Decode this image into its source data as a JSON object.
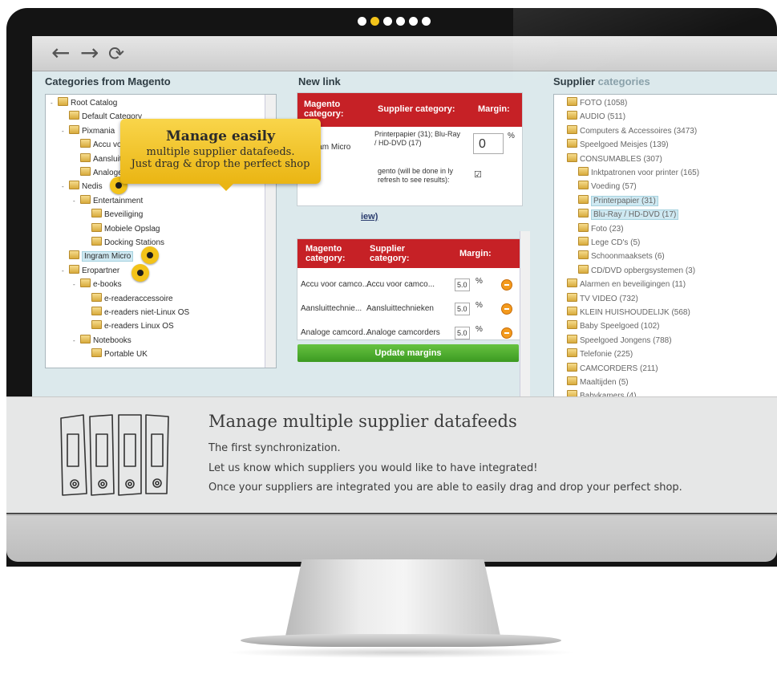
{
  "carousel": {
    "dots": [
      {
        "active": false
      },
      {
        "active": true
      },
      {
        "active": false
      },
      {
        "active": false
      },
      {
        "active": false
      },
      {
        "active": false
      }
    ]
  },
  "browser": {
    "back_icon": "back-arrow-icon",
    "forward_icon": "forward-arrow-icon",
    "refresh_icon": "refresh-icon",
    "back": "←",
    "forward": "→",
    "refresh": "⟳"
  },
  "left_panel": {
    "title": "Categories from Magento",
    "tree": [
      {
        "label": "Root Catalog",
        "depth": 0,
        "expander": "-"
      },
      {
        "label": "Default Category",
        "depth": 1
      },
      {
        "label": "Pixmania",
        "depth": 1,
        "expander": "-"
      },
      {
        "label": "Accu voor camcorder",
        "depth": 2
      },
      {
        "label": "Aansluittechnieken",
        "depth": 2
      },
      {
        "label": "Analoge camcorders",
        "depth": 2
      },
      {
        "label": "Nedis",
        "depth": 1,
        "expander": "-"
      },
      {
        "label": "Entertainment",
        "depth": 2,
        "expander": "-"
      },
      {
        "label": "Beveiliging",
        "depth": 3
      },
      {
        "label": "Mobiele Opslag",
        "depth": 3
      },
      {
        "label": "Docking Stations",
        "depth": 3
      },
      {
        "label": "Ingram Micro",
        "depth": 1,
        "selected": true
      },
      {
        "label": "Eropartner",
        "depth": 1,
        "expander": "-"
      },
      {
        "label": "e-books",
        "depth": 2,
        "expander": "-"
      },
      {
        "label": "e-readeraccessoire",
        "depth": 3
      },
      {
        "label": "e-readers niet-Linux OS",
        "depth": 3
      },
      {
        "label": "e-readers Linux OS",
        "depth": 3
      },
      {
        "label": "Notebooks",
        "depth": 2,
        "expander": "-"
      },
      {
        "label": "Portable UK",
        "depth": 3
      }
    ]
  },
  "callout": {
    "title": "Manage easily",
    "line1": "multiple supplier datafeeds.",
    "line2": "Just drag & drop the perfect shop"
  },
  "middle_panel": {
    "title": "New link",
    "link_table": {
      "headers": [
        "Magento category:",
        "Supplier category:",
        "Margin:"
      ],
      "magento": "Ingram Micro",
      "supplier": "Printerpapier (31); Blu-Ray / HD-DVD (17)",
      "margin_value": "0",
      "percent": "%",
      "note": "gento (will be done in ly refresh to see results):",
      "checkbox": "☑"
    },
    "overview_link": "iew)",
    "margins_table": {
      "headers": [
        "Magento category:",
        "Supplier category:",
        "Margin:"
      ],
      "rows": [
        {
          "magento": "Accu voor camco...",
          "supplier": "Accu voor camco...",
          "margin": "5.0",
          "percent": "%"
        },
        {
          "magento": "Aansluittechnie...",
          "supplier": "Aansluittechnieken",
          "margin": "5.0",
          "percent": "%"
        },
        {
          "magento": "Analoge camcord...",
          "supplier": "Analoge camcorders",
          "margin": "5.0",
          "percent": "%"
        }
      ]
    },
    "update_button": "Update margins"
  },
  "right_panel": {
    "title_strong": "Supplier",
    "title_light": "categories",
    "tree": [
      {
        "label": "FOTO (1058)",
        "depth": 0
      },
      {
        "label": "AUDIO (511)",
        "depth": 0
      },
      {
        "label": "Computers & Accessoires (3473)",
        "depth": 0
      },
      {
        "label": "Speelgoed Meisjes (139)",
        "depth": 0
      },
      {
        "label": "CONSUMABLES (307)",
        "depth": 0
      },
      {
        "label": "Inktpatronen voor printer (165)",
        "depth": 1
      },
      {
        "label": "Voeding (57)",
        "depth": 1
      },
      {
        "label": "Printerpapier (31)",
        "depth": 1,
        "selected": true
      },
      {
        "label": "Blu-Ray / HD-DVD (17)",
        "depth": 1,
        "selected": true
      },
      {
        "label": "Foto (23)",
        "depth": 1
      },
      {
        "label": "Lege CD's (5)",
        "depth": 1
      },
      {
        "label": "Schoonmaaksets (6)",
        "depth": 1
      },
      {
        "label": "CD/DVD opbergsystemen (3)",
        "depth": 1
      },
      {
        "label": "Alarmen en beveiligingen (11)",
        "depth": 0
      },
      {
        "label": "TV VIDEO (732)",
        "depth": 0
      },
      {
        "label": "KLEIN HUISHOUDELIJK (568)",
        "depth": 0
      },
      {
        "label": "Baby Speelgoed (102)",
        "depth": 0
      },
      {
        "label": "Speelgoed Jongens (788)",
        "depth": 0
      },
      {
        "label": "Telefonie (225)",
        "depth": 0
      },
      {
        "label": "CAMCORDERS (211)",
        "depth": 0
      },
      {
        "label": "Maaltijden (5)",
        "depth": 0
      },
      {
        "label": "Babykamers (4)",
        "depth": 0
      }
    ]
  },
  "info": {
    "icon": "binders-icon",
    "heading": "Manage multiple supplier datafeeds",
    "lines": [
      "The first synchronization.",
      "Let us know which suppliers you would like to have integrated!",
      "Once your suppliers are integrated you are able to easily drag and drop your perfect shop."
    ]
  },
  "colors": {
    "accent": "#f3c31a",
    "table_header": "#c62126",
    "button": "#4caf2e",
    "band": "#e6e7e7"
  }
}
